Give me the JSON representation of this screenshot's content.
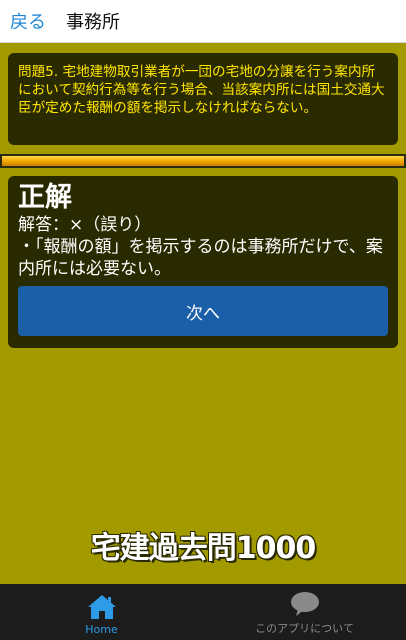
{
  "header": {
    "back_label": "戻る",
    "title": "事務所"
  },
  "question": {
    "text": "問題5. 宅地建物取引業者が一団の宅地の分譲を行う案内所において契約行為等を行う場合、当該案内所には国土交通大臣が定めた報酬の額を掲示しなければならない。"
  },
  "progress": {
    "fraction": 1.0,
    "color": "#f2a400"
  },
  "answer": {
    "result": "正解",
    "answer_label": "解答：×（誤り）",
    "explanation": "・「報酬の額」を掲示するのは事務所だけで、案内所には必要ない。",
    "next_label": "次へ"
  },
  "app_title": "宅建過去問1000",
  "bottom_nav": {
    "home": {
      "label": "Home",
      "icon": "home-icon",
      "color": "#2e9be8"
    },
    "about": {
      "label": "このアプリについて",
      "icon": "chat-bubble-icon",
      "color": "#8a8a8a"
    }
  },
  "colors": {
    "background": "#a39a00",
    "panel": "#2a2a00",
    "question_text": "#ffe600",
    "button": "#1a5fa8"
  }
}
